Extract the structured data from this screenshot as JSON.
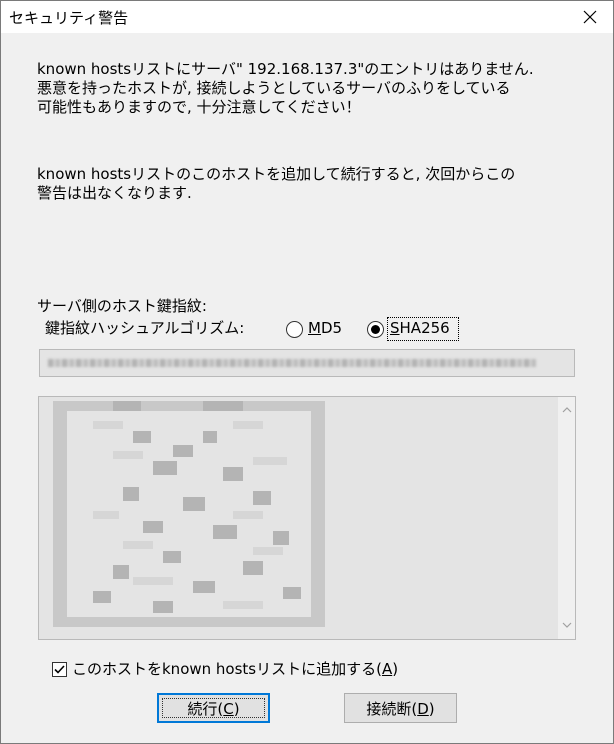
{
  "window": {
    "title": "セキュリティ警告",
    "close_glyph": "✕"
  },
  "message": {
    "line1": "known hostsリストにサーバ\" 192.168.137.3\"のエントリはありません.",
    "line2": "悪意を持ったホストが, 接続しようとしているサーバのふりをしている",
    "line3": "可能性もありますので, 十分注意してください！",
    "line4": "known hostsリストのこのホストを追加して続行すると, 次回からこの",
    "line5": "警告は出なくなります."
  },
  "fingerprint": {
    "section_label": "サーバ側のホスト鍵指紋:",
    "algorithm_label": "鍵指紋ハッシュアルゴリズム:",
    "options": [
      {
        "label": "MD5",
        "mnemonic": "M",
        "rest": "D5",
        "selected": false
      },
      {
        "label": "SHA256",
        "mnemonic": "S",
        "rest": "HA256",
        "selected": true
      }
    ],
    "value_obscured": true
  },
  "randomart": {
    "obscured": true,
    "scroll_up_icon": "chevron-up-icon",
    "scroll_down_icon": "chevron-down-icon"
  },
  "add_to_known_hosts": {
    "label_prefix": "このホストをknown hostsリストに追加する(",
    "mnemonic": "A",
    "label_suffix": ")",
    "checked": true
  },
  "buttons": {
    "continue": {
      "prefix": "続行(",
      "mnemonic": "C",
      "suffix": ")"
    },
    "disconnect": {
      "prefix": "接続断(",
      "mnemonic": "D",
      "suffix": ")"
    }
  },
  "colors": {
    "dialog_bg": "#f0f0f0",
    "title_bg": "#ffffff",
    "default_button_border": "#0078d7",
    "field_bg": "#e4e4e4"
  }
}
